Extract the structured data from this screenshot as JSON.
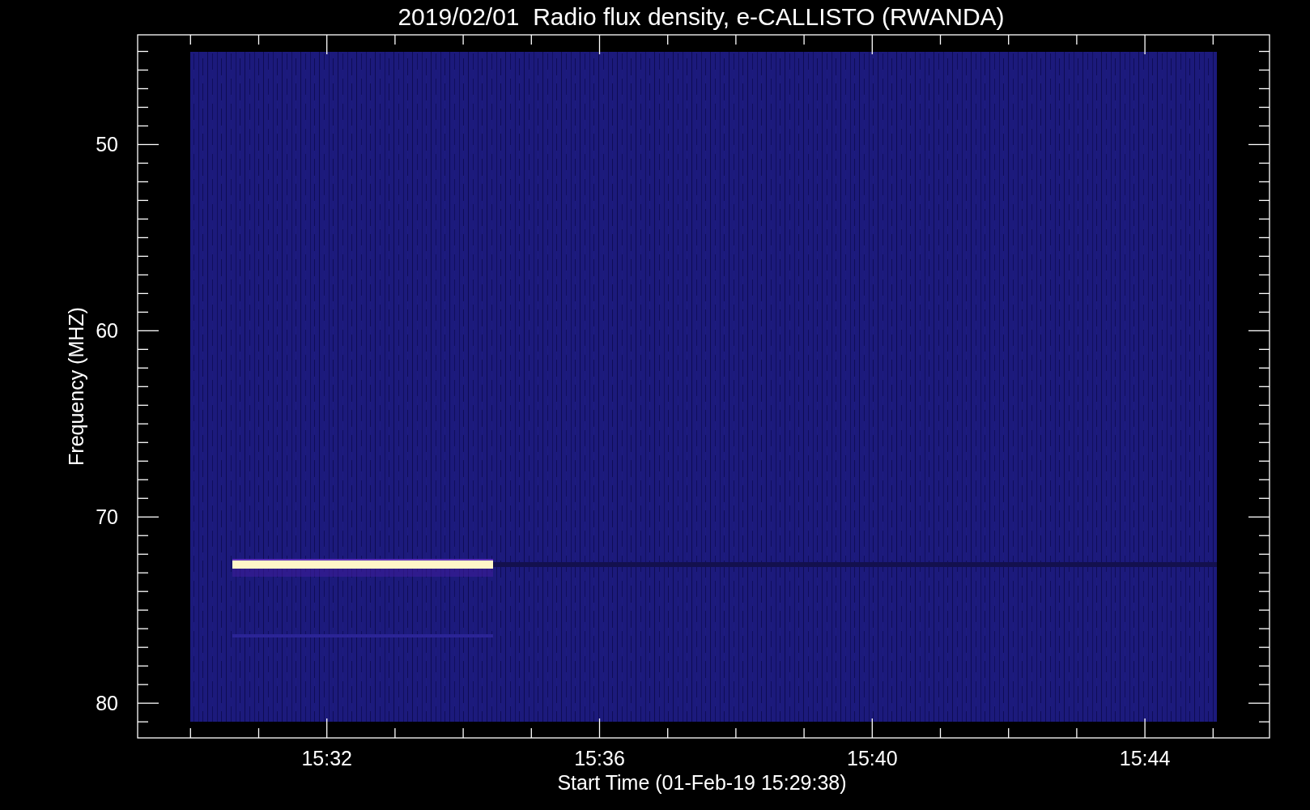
{
  "title": "2019/02/01  Radio flux density, e-CALLISTO (RWANDA)",
  "x_axis": {
    "label": "Start Time (01-Feb-19 15:29:38)",
    "ticks": [
      "15:32",
      "15:36",
      "15:40",
      "15:44"
    ]
  },
  "y_axis": {
    "label": "Frequency (MHZ)",
    "ticks": [
      "50",
      "60",
      "70",
      "80"
    ]
  }
}
